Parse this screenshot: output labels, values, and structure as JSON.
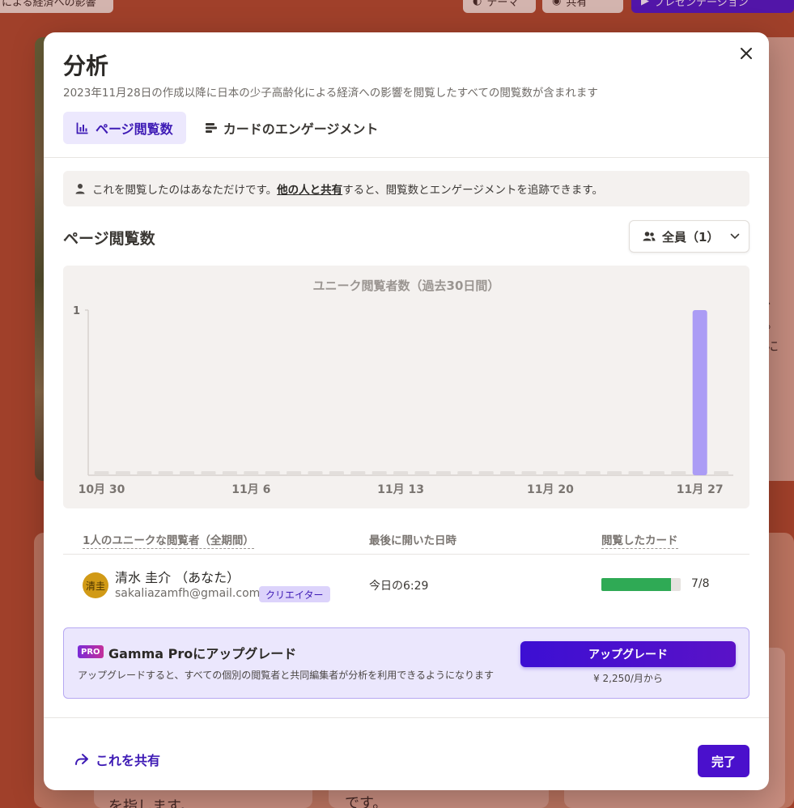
{
  "background": {
    "tab_left_text": "による経済への影響",
    "theme_label": "テーマ",
    "share_label": "共有",
    "present_label": "プレゼンテーション",
    "right_text_1": "、",
    "right_text_2": "。",
    "right_text_3": "に",
    "lower_text_1": "を指します。",
    "lower_text_2": "です。"
  },
  "modal": {
    "title": "分析",
    "subtitle": "2023年11月28日の作成以降に日本の少子高齢化による経済への影響を閲覧したすべての閲覧数が含まれます",
    "tabs": [
      {
        "label": "ページ閲覧数",
        "icon": "bar-chart-icon",
        "active": true
      },
      {
        "label": "カードのエンゲージメント",
        "icon": "cards-icon",
        "active": false
      }
    ],
    "info": {
      "before": "これを閲覧したのはあなただけです。",
      "link": "他の人と共有",
      "after": "すると、閲覧数とエンゲージメントを追跡できます。"
    },
    "section_title": "ページ閲覧数",
    "filter": {
      "label": "全員（1）",
      "icon": "users-icon"
    },
    "table": {
      "col_viewers": "1人のユニークな閲覧者（全期間）",
      "col_last_opened": "最後に開いた日時",
      "col_cards": "閲覧したカード"
    },
    "viewer": {
      "avatar": "清圭",
      "name": "清水 圭介 （あなた）",
      "email": "sakaliazamfh@gmail.com",
      "role": "クリエイター",
      "last_opened": "今日の6:29",
      "cards_viewed": 7,
      "cards_total": 8,
      "cards_label": "7/8"
    },
    "upgrade": {
      "badge": "PRO",
      "title": "Gamma Proにアップグレード",
      "description": "アップグレードすると、すべての個別の閲覧者と共同編集者が分析を利用できるようになります",
      "button": "アップグレード",
      "price": "¥ 2,250/月から"
    },
    "footer": {
      "share_label": "これを共有",
      "done_label": "完了"
    }
  },
  "colors": {
    "accent": "#3e1bb5",
    "bar": "#ab9cf5",
    "empty_bar": "#e2dedb",
    "progress": "#2faa55"
  },
  "chart_data": {
    "type": "bar",
    "title": "ユニーク閲覧者数（過去30日間）",
    "xlabel": "",
    "ylabel": "",
    "ylim": [
      0,
      1
    ],
    "yticks": [
      1
    ],
    "tick_labels": [
      "10月 30",
      "11月 6",
      "11月 13",
      "11月 20",
      "11月 27"
    ],
    "categories": [
      "10月 30",
      "10月 31",
      "11月 1",
      "11月 2",
      "11月 3",
      "11月 4",
      "11月 5",
      "11月 6",
      "11月 7",
      "11月 8",
      "11月 9",
      "11月 10",
      "11月 11",
      "11月 12",
      "11月 13",
      "11月 14",
      "11月 15",
      "11月 16",
      "11月 17",
      "11月 18",
      "11月 19",
      "11月 20",
      "11月 21",
      "11月 22",
      "11月 23",
      "11月 24",
      "11月 25",
      "11月 26",
      "11月 27",
      "11月 28"
    ],
    "values": [
      0,
      0,
      0,
      0,
      0,
      0,
      0,
      0,
      0,
      0,
      0,
      0,
      0,
      0,
      0,
      0,
      0,
      0,
      0,
      0,
      0,
      0,
      0,
      0,
      0,
      0,
      0,
      0,
      1,
      0
    ],
    "grid": false
  }
}
